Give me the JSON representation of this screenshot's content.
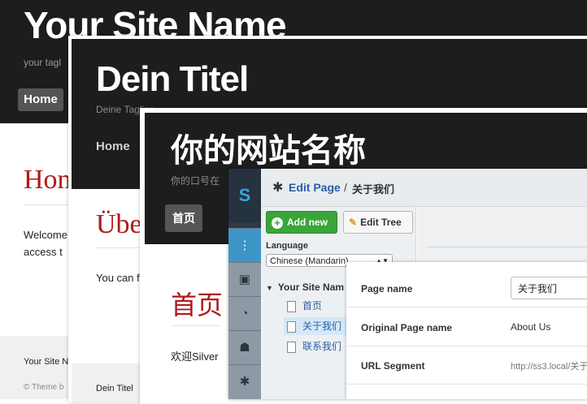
{
  "english_site": {
    "title": "Your Site Name",
    "tagline": "your tagl",
    "nav_home": "Home",
    "heading": "Hom",
    "body_line1": "Welcome",
    "body_line2": "access t",
    "footer_name": "Your Site N",
    "footer_theme": "© Theme b"
  },
  "german_site": {
    "title": "Dein Titel",
    "tagline": "Deine Tagline",
    "nav_home": "Home",
    "heading": "Übe",
    "body_text": "You can f",
    "footer_name": "Dein Titel"
  },
  "chinese_site": {
    "title": "你的网站名称",
    "tagline": "你的口号在",
    "nav_home": "首页",
    "heading": "首页",
    "body_text": "欢迎Silver"
  },
  "cms": {
    "logo": "S",
    "breadcrumb": {
      "edit_page": "Edit Page",
      "separator": "/",
      "current": "关于我们"
    },
    "add_new_label": "Add new",
    "edit_tree_label": "Edit Tree",
    "language_label": "Language",
    "language_value": "Chinese (Mandarin)",
    "tree_root": "Your Site Nam",
    "tree_items": [
      "首页",
      "关于我们",
      "联系我们"
    ],
    "form": {
      "page_name_label": "Page name",
      "page_name_value": "关于我们",
      "original_label": "Original Page name",
      "original_value": "About Us",
      "url_label": "URL Segment",
      "url_value": "http://ss3.local/关于"
    }
  },
  "colors": {
    "header_dark": "#1d1d1d",
    "heading_red": "#b01a1a",
    "cms_blue": "#2a5ea8",
    "add_green": "#3aa53a"
  }
}
